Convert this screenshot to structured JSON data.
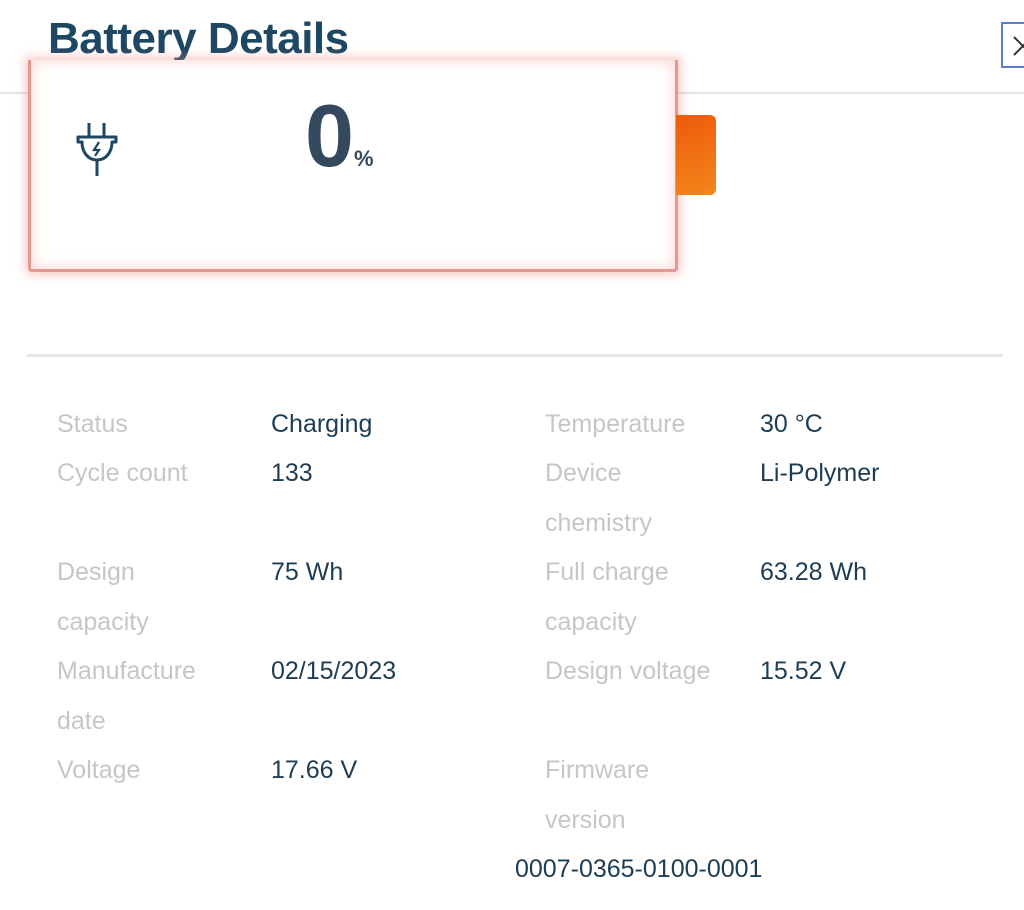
{
  "header": {
    "title": "Battery Details",
    "close_icon": "close-icon"
  },
  "battery": {
    "percent_value": "0",
    "percent_sign": "%",
    "charge_fraction": 0.0,
    "icon": "plug-charging-icon",
    "colors": {
      "outline": "#e39892",
      "tip": "#ee5a0b",
      "text": "#34495e"
    }
  },
  "details": {
    "left": [
      {
        "label": "Status",
        "value": "Charging"
      },
      {
        "label": "Cycle count",
        "value": "133"
      },
      {
        "label": "Design capacity",
        "value": "75 Wh"
      },
      {
        "label": "Manufacture date",
        "value": "02/15/2023"
      },
      {
        "label": "Voltage",
        "value": "17.66 V"
      }
    ],
    "right": [
      {
        "label": "Temperature",
        "value": "30 °C"
      },
      {
        "label": "Device chemistry",
        "value": "Li-Polymer"
      },
      {
        "label": "Full charge capacity",
        "value": "63.28 Wh"
      },
      {
        "label": "Design voltage",
        "value": "15.52 V"
      },
      {
        "label": "Firmware version",
        "value": "0007-0365-0100-0001"
      }
    ]
  }
}
